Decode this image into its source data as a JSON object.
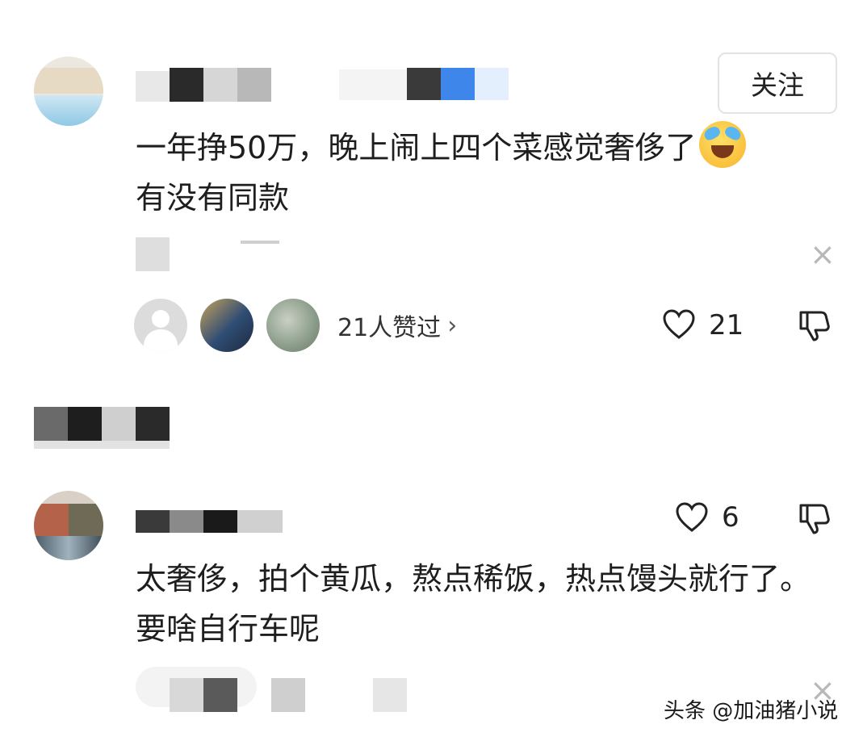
{
  "comment1": {
    "follow_label": "关注",
    "text_line1": "一年挣50万，晚上闹上四个菜感觉奢侈了",
    "text_line2": "有没有同款",
    "likers_text": "21人赞过",
    "chevron": "›",
    "like_count": "21",
    "close_glyph": "×"
  },
  "comment2": {
    "like_count": "6",
    "text": "太奢侈，拍个黄瓜，熬点稀饭，热点馒头就行了。要啥自行车呢",
    "close_glyph": "×"
  },
  "watermark": "头条 @加油猪小说",
  "colors": {
    "text": "#1e1e1e",
    "muted": "#b8b8b8",
    "border": "#e3e3e3"
  }
}
